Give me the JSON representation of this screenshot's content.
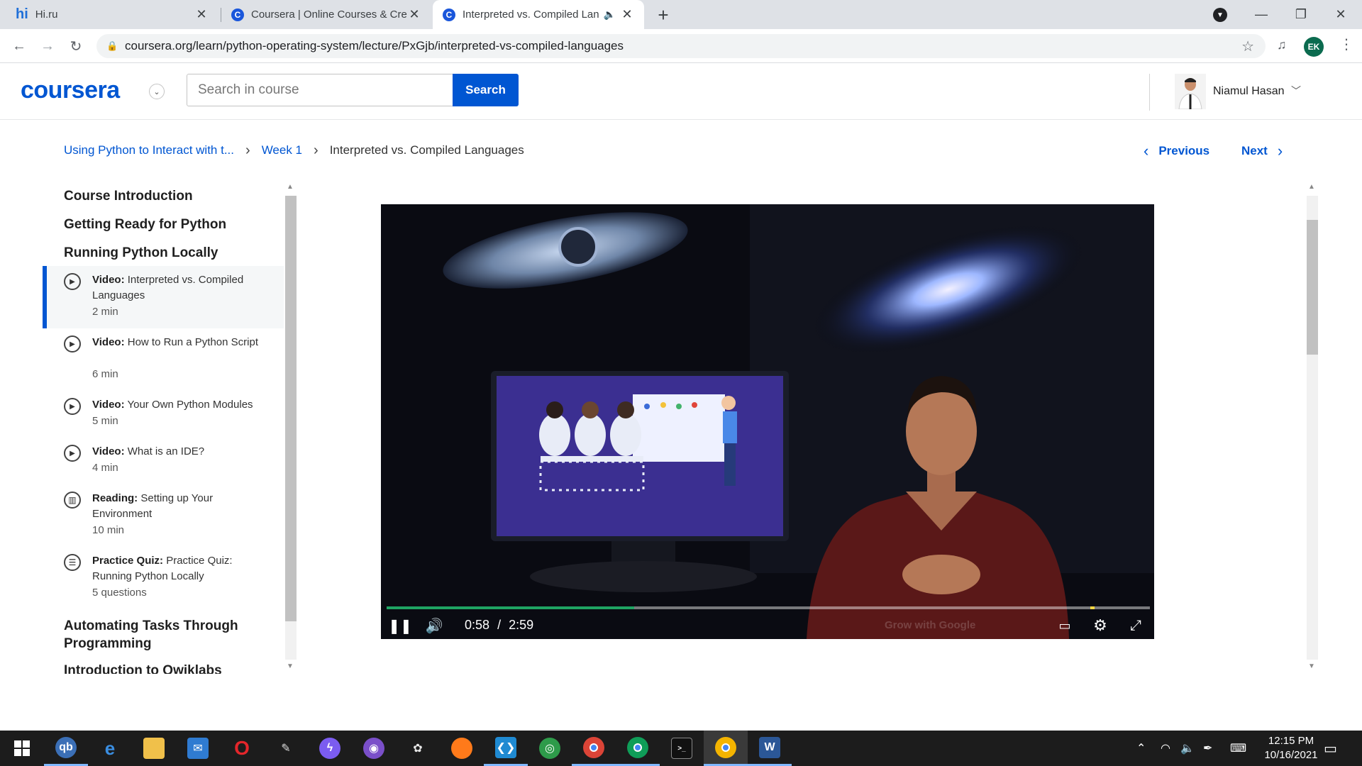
{
  "browser": {
    "tabs": [
      {
        "title": "Hi.ru",
        "favicon": "hi-logo-icon"
      },
      {
        "title": "Coursera | Online Courses & Credentials From Top Educators",
        "favicon": "coursera-favicon-icon"
      },
      {
        "title": "Interpreted vs. Compiled Languages",
        "favicon": "coursera-favicon-icon",
        "active": true,
        "audio": true
      }
    ],
    "url": "coursera.org/learn/python-operating-system/lecture/PxGjb/interpreted-vs-compiled-languages",
    "profile_initials": "EK"
  },
  "header": {
    "logo": "coursera",
    "search_placeholder": "Search in course",
    "search_button": "Search",
    "user_name": "Niamul Hasan"
  },
  "breadcrumb": {
    "course": "Using Python to Interact with t...",
    "week": "Week 1",
    "current": "Interpreted vs. Compiled Languages"
  },
  "pager": {
    "previous": "Previous",
    "next": "Next"
  },
  "sidebar": {
    "sections": [
      "Course Introduction",
      "Getting Ready for Python",
      "Running Python Locally",
      "Automating Tasks Through Programming",
      "Introduction to Qwiklabs"
    ],
    "items": [
      {
        "kind": "Video:",
        "title": "Interpreted vs. Compiled Languages",
        "meta": "2 min",
        "icon": "play-icon",
        "selected": true
      },
      {
        "kind": "Video:",
        "title": "How to Run a Python Script",
        "meta": "6 min",
        "icon": "play-icon"
      },
      {
        "kind": "Video:",
        "title": "Your Own Python Modules",
        "meta": "5 min",
        "icon": "play-icon"
      },
      {
        "kind": "Video:",
        "title": "What is an IDE?",
        "meta": "4 min",
        "icon": "play-icon"
      },
      {
        "kind": "Reading:",
        "title": "Setting up Your Environment",
        "meta": "10 min",
        "icon": "book-icon"
      },
      {
        "kind": "Practice Quiz:",
        "title": "Practice Quiz: Running Python Locally",
        "meta": "5 questions",
        "icon": "quiz-icon"
      }
    ]
  },
  "video": {
    "current_time": "0:58",
    "separator": "/",
    "duration": "2:59",
    "progress": 0.324,
    "buffered_marker": 0.922,
    "watermark": "Grow with Google"
  },
  "taskbar": {
    "apps": [
      "start-icon",
      "qbittorrent-icon",
      "edge-icon",
      "file-explorer-icon",
      "mail-icon",
      "opera-icon",
      "inkscape-icon",
      "messenger-icon",
      "github-desktop-icon",
      "paint-icon",
      "firefox-icon",
      "vscode-icon",
      "network-app-icon",
      "chrome-icon",
      "chrome-profile-icon",
      "terminal-icon",
      "chrome-ek-icon",
      "word-icon"
    ],
    "time": "12:15 PM",
    "date": "10/16/2021"
  },
  "colors": {
    "coursera_blue": "#0056d2",
    "progress_green": "#1fa463",
    "taskbar": "#1c1c1c"
  }
}
